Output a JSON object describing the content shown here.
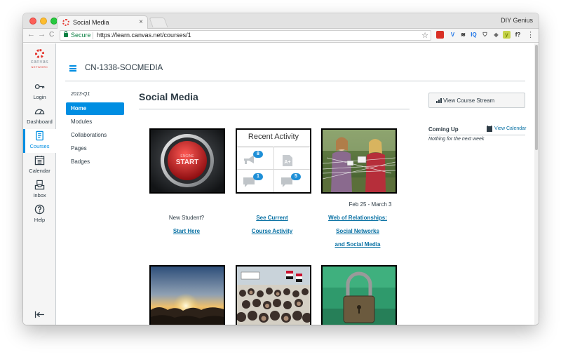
{
  "browser": {
    "tab_title": "Social Media",
    "tab_close": "×",
    "profile_name": "DIY Genius",
    "secure_label": "Secure",
    "url": "https://learn.canvas.net/courses/1",
    "star": "☆",
    "menu": "⋮",
    "nav": {
      "back": "←",
      "forward": "→",
      "reload": "C"
    },
    "extensions": [
      {
        "label": "",
        "color": "#d93025"
      },
      {
        "label": "V",
        "color": "#1a73e8"
      },
      {
        "label": "≋",
        "color": "#111111"
      },
      {
        "label": "IQ",
        "color": "#1a73e8"
      },
      {
        "label": "⛉",
        "color": "#444444"
      },
      {
        "label": "◈",
        "color": "#666666"
      },
      {
        "label": "y",
        "color": "#7a8b00"
      },
      {
        "label": "f?",
        "color": "#222222"
      }
    ]
  },
  "brand": {
    "logo_text": "canvas",
    "logo_sub": "NETWORK",
    "accent": "#008ee2",
    "logo_red": "#e4342c"
  },
  "global_nav": [
    {
      "label": "Login",
      "icon": "key-icon"
    },
    {
      "label": "Dashboard",
      "icon": "dashboard-icon"
    },
    {
      "label": "Courses",
      "icon": "courses-icon",
      "active": true
    },
    {
      "label": "Calendar",
      "icon": "calendar-icon"
    },
    {
      "label": "Inbox",
      "icon": "inbox-icon"
    },
    {
      "label": "Help",
      "icon": "help-icon"
    }
  ],
  "header": {
    "course_code": "CN-1338-SOCMEDIA"
  },
  "course_nav": {
    "term": "2013-Q1",
    "items": [
      "Home",
      "Modules",
      "Collaborations",
      "Pages",
      "Badges"
    ]
  },
  "main": {
    "title": "Social Media",
    "tiles": [
      {
        "name": "start-tile",
        "caption": "",
        "label": "New Student?",
        "link1": "Start Here",
        "link2": "",
        "link3": ""
      },
      {
        "name": "recent-activity-tile",
        "caption": "",
        "label": "",
        "link1": "See Current",
        "link2": "Course Activity",
        "link3": ""
      },
      {
        "name": "relationships-tile",
        "caption": "Feb 25 - March 3",
        "label": "",
        "link1": "Web of Relationships:",
        "link2": "Social Networks",
        "link3": "and Social Media"
      }
    ],
    "recent_activity": {
      "heading": "Recent Activity",
      "badges": [
        "8",
        "1",
        "5"
      ]
    }
  },
  "sidebar": {
    "stream_button": "View Course Stream",
    "coming_up": "Coming Up",
    "view_calendar": "View Calendar",
    "nothing": "Nothing for the next week"
  }
}
